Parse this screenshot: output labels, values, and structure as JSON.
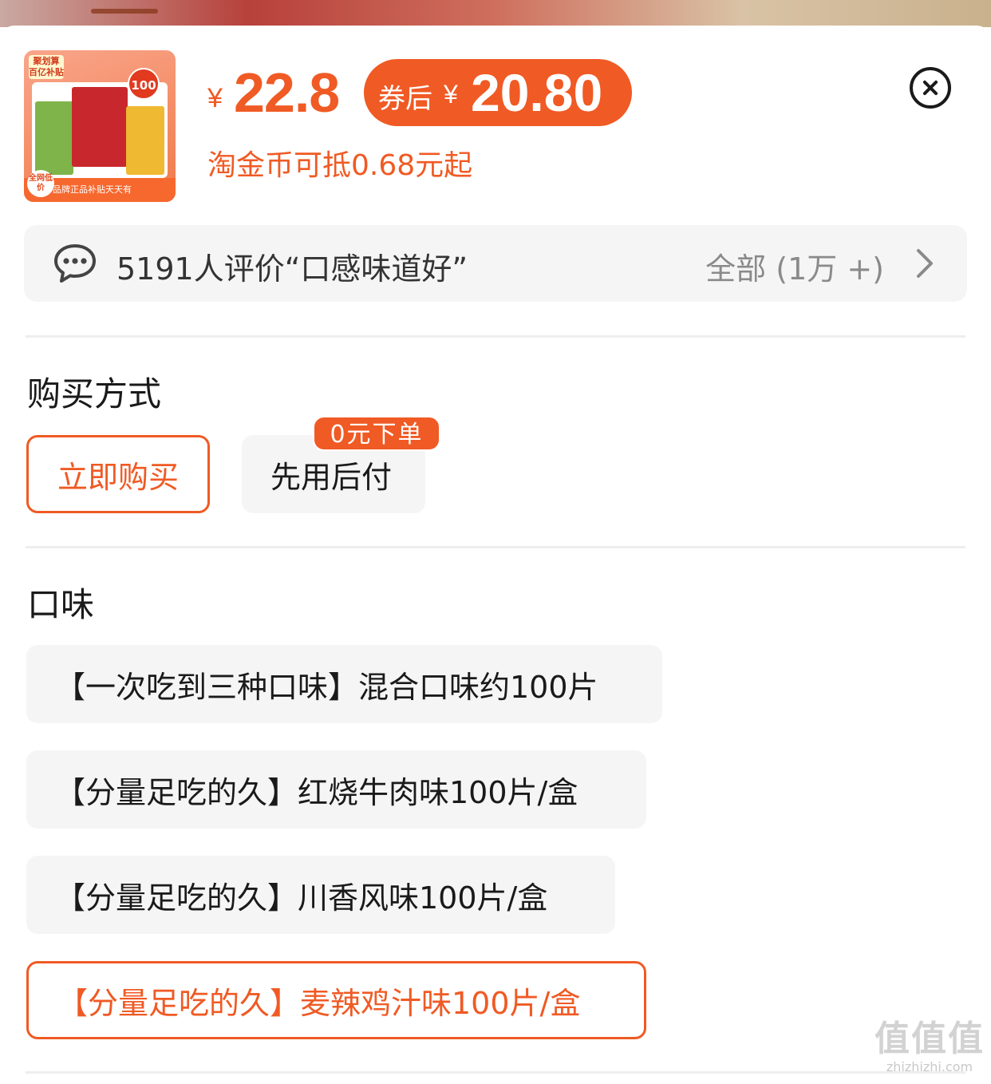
{
  "product": {
    "thumbnail": {
      "tag": "聚划算 百亿补贴",
      "count_badge": "100",
      "footer": "品牌正品补贴天天有",
      "corner": "全网低价"
    },
    "price_currency": "¥",
    "price": "22.8",
    "coupon": {
      "label": "券后",
      "currency": "¥",
      "price": "20.80",
      "color": "#f05a24"
    },
    "coin_note": "淘金币可抵0.68元起"
  },
  "close_icon": "close-circle-icon",
  "review": {
    "icon": "chat-bubble-icon",
    "text": "5191人评价“口感味道好”",
    "all_label": "全部 (1万 +)",
    "chevron": "chevron-right-icon"
  },
  "purchase": {
    "title": "购买方式",
    "options": [
      {
        "label": "立即购买",
        "selected": true
      },
      {
        "label": "先用后付",
        "selected": false,
        "badge": "0元下单"
      }
    ]
  },
  "flavor": {
    "title": "口味",
    "options": [
      {
        "label": "【一次吃到三种口味】混合口味约100片",
        "selected": false
      },
      {
        "label": "【分量足吃的久】红烧牛肉味100片/盒",
        "selected": false
      },
      {
        "label": "【分量足吃的久】川香风味100片/盒",
        "selected": false
      },
      {
        "label": "【分量足吃的久】麦辣鸡汁味100片/盒",
        "selected": true
      }
    ]
  },
  "watermark": {
    "main": "值值值",
    "sub": "zhizhizhi.com"
  },
  "colors": {
    "accent": "#f05a24",
    "chip_bg": "#f5f5f5",
    "divider": "#eeeeee"
  }
}
